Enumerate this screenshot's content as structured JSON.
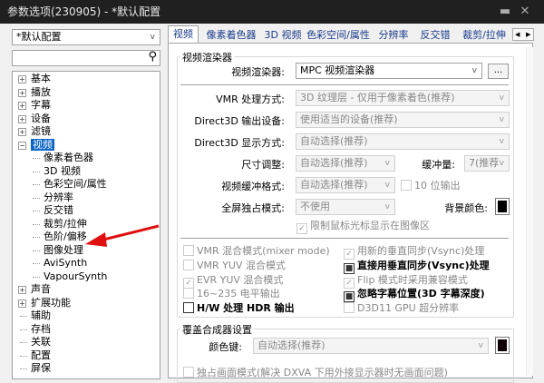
{
  "window": {
    "title": "参数选项(230905) - *默认配置",
    "pin_icon": "pin-icon",
    "close_icon": "close-icon"
  },
  "sidebar": {
    "profile": "*默认配置",
    "search_placeholder": "",
    "tree": [
      {
        "label": "基本",
        "level": 0,
        "expander": "+"
      },
      {
        "label": "播放",
        "level": 0,
        "expander": "+"
      },
      {
        "label": "字幕",
        "level": 0,
        "expander": "+"
      },
      {
        "label": "设备",
        "level": 0,
        "expander": "+"
      },
      {
        "label": "滤镜",
        "level": 0,
        "expander": "+"
      },
      {
        "label": "视频",
        "level": 0,
        "expander": "-",
        "selected": true
      },
      {
        "label": "像素着色器",
        "level": 1
      },
      {
        "label": "3D 视频",
        "level": 1
      },
      {
        "label": "色彩空间/属性",
        "level": 1
      },
      {
        "label": "分辨率",
        "level": 1
      },
      {
        "label": "反交错",
        "level": 1
      },
      {
        "label": "裁剪/拉伸",
        "level": 1
      },
      {
        "label": "色阶/偏移",
        "level": 1
      },
      {
        "label": "图像处理",
        "level": 1
      },
      {
        "label": "AviSynth",
        "level": 1
      },
      {
        "label": "VapourSynth",
        "level": 1
      },
      {
        "label": "声音",
        "level": 0,
        "expander": "+"
      },
      {
        "label": "扩展功能",
        "level": 0,
        "expander": "+"
      },
      {
        "label": "辅助",
        "level": 0
      },
      {
        "label": "存档",
        "level": 0
      },
      {
        "label": "关联",
        "level": 0
      },
      {
        "label": "配置",
        "level": 0
      },
      {
        "label": "屏保",
        "level": 0
      }
    ]
  },
  "tabs": [
    "视频",
    "像素着色器",
    "3D 视频",
    "色彩空间/属性",
    "分辨率",
    "反交错",
    "裁剪/拉伸"
  ],
  "renderer_group": {
    "title": "视频渲染器",
    "renderer_label": "视频渲染器:",
    "renderer_value": "MPC 视频渲染器",
    "more_button": "...",
    "vmr_label": "VMR 处理方式:",
    "vmr_value": "3D 纹理层 - 仅用于像素着色(推荐)",
    "d3d_device_label": "Direct3D 输出设备:",
    "d3d_device_value": "使用适当的设备(推荐)",
    "d3d_display_label": "Direct3D 显示方式:",
    "d3d_display_value": "自动选择(推荐)",
    "resize_label": "尺寸调整:",
    "resize_value": "自动选择(推荐)",
    "buffer_label": "缓冲量:",
    "buffer_value": "7(推荐",
    "buffer_format_label": "视频缓冲格式:",
    "buffer_format_value": "自动选择(推荐)",
    "ten_bit": "10 位输出",
    "fullscreen_label": "全屏独占模式:",
    "fullscreen_value": "不使用",
    "bg_color_label": "背景颜色:",
    "bg_color": "#000000",
    "limit_cursor": "限制鼠标光标显示在图像区",
    "checkboxes_left": [
      {
        "label": "VMR 混合模式(mixer mode)",
        "state": "off"
      },
      {
        "label": "VMR YUV 混合模式",
        "state": "off"
      },
      {
        "label": "EVR YUV 混合模式",
        "state": "checked-disabled"
      },
      {
        "label": "16~235 电平输出",
        "state": "off"
      },
      {
        "label": "H/W 处理 HDR 输出",
        "state": "off-bold"
      }
    ],
    "checkboxes_right": [
      {
        "label": "用新的垂直同步(Vsync)处理",
        "state": "checked-disabled"
      },
      {
        "label": "直接用垂直同步(Vsync)处理",
        "state": "indeterminate-bold"
      },
      {
        "label": "Flip 模式时采用兼容模式",
        "state": "checked-disabled"
      },
      {
        "label": "忽略字幕位置(3D 字幕深度)",
        "state": "indeterminate-bold"
      },
      {
        "label": "D3D11 GPU 超分辨率",
        "state": "off"
      }
    ]
  },
  "overlay_group": {
    "title": "覆盖合成器设置",
    "color_key_label": "颜色键:",
    "color_key_value": "自动选择(推荐)",
    "color_key_swatch": "#100008",
    "exclusive": "独占画面模式(解决 DXVA 下用外接显示器时无画面问题)"
  }
}
